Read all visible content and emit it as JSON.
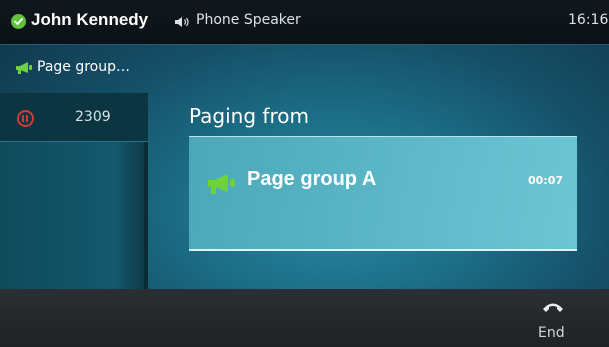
{
  "status_bar": {
    "user_name": "John Kennedy",
    "presence": "online",
    "audio_device": "Phone Speaker",
    "clock": "16:16"
  },
  "line": {
    "label": "Page group…"
  },
  "calls": [
    {
      "status": "hold",
      "number": "2309"
    }
  ],
  "paging": {
    "title": "Paging from",
    "group_name": "Page group A",
    "duration": "00:07"
  },
  "softkeys": {
    "end_label": "End"
  },
  "colors": {
    "presence_green": "#5fc23a",
    "megaphone_green": "#6ed23a",
    "hold_red": "#d23a2f"
  },
  "icons": {
    "presence": "check-circle-icon",
    "speaker": "speaker-icon",
    "megaphone": "megaphone-icon",
    "hold": "pause-circle-icon",
    "end": "hang-up-icon"
  }
}
